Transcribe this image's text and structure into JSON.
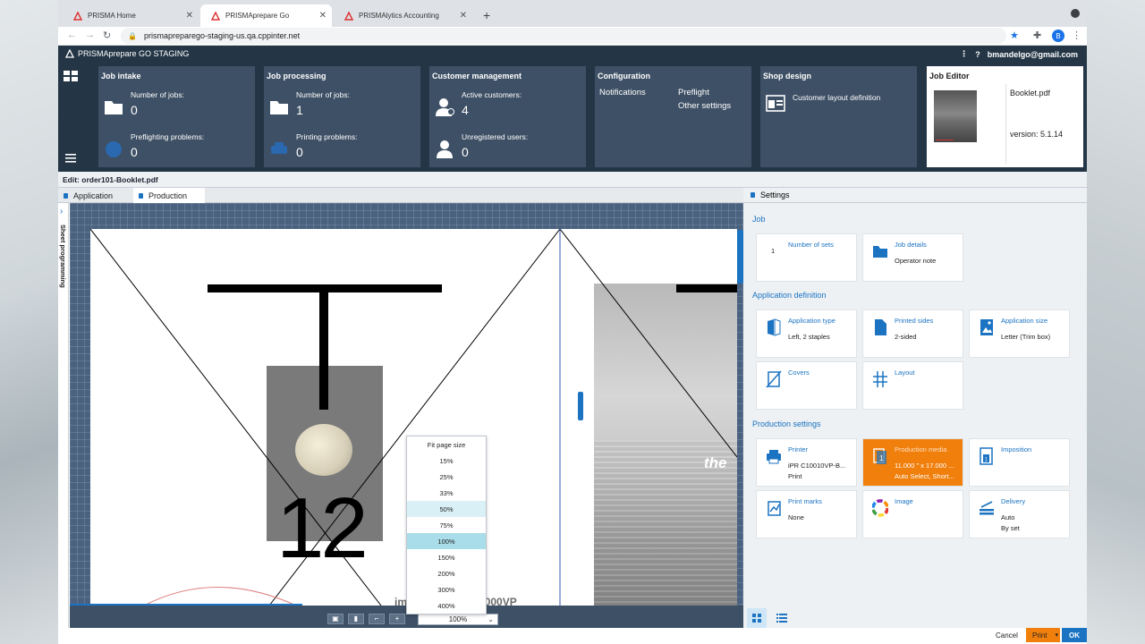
{
  "browser": {
    "tabs": [
      {
        "label": "PRISMA Home",
        "active": false
      },
      {
        "label": "PRISMAprepare Go",
        "active": true
      },
      {
        "label": "PRISMAlytics Accounting",
        "active": false
      }
    ],
    "url": "prismapreparego-staging-us.qa.cppinter.net",
    "avatar_letter": "B"
  },
  "app": {
    "title": "PRISMAprepare GO STAGING",
    "user": "bmandelgo@gmail.com"
  },
  "dashboard": {
    "job_intake": {
      "title": "Job intake",
      "stat1_label": "Number of jobs:",
      "stat1_value": "0",
      "stat2_label": "Preflighting problems:",
      "stat2_value": "0"
    },
    "job_processing": {
      "title": "Job processing",
      "stat1_label": "Number of jobs:",
      "stat1_value": "1",
      "stat2_label": "Printing problems:",
      "stat2_value": "0"
    },
    "customer_management": {
      "title": "Customer management",
      "stat1_label": "Active customers:",
      "stat1_value": "4",
      "stat2_label": "Unregistered users:",
      "stat2_value": "0"
    },
    "configuration": {
      "title": "Configuration",
      "notifications": "Notifications",
      "preflight": "Preflight",
      "other_settings": "Other settings"
    },
    "shop_design": {
      "title": "Shop design",
      "item": "Customer layout definition"
    },
    "job_editor": {
      "title": "Job Editor",
      "file": "Booklet.pdf",
      "version": "version: 5.1.14"
    }
  },
  "editor": {
    "edit_path": "Edit: order101-Booklet.pdf",
    "tabs": [
      "Application",
      "Production"
    ],
    "side_tab": "Sheet programming",
    "canvas": {
      "big_number": "12",
      "overlay_word": "the",
      "bottom_text": "imagePRESS C10000VP"
    },
    "zoom": {
      "current": "100%",
      "options": [
        "Fit page size",
        "15%",
        "25%",
        "33%",
        "50%",
        "75%",
        "100%",
        "150%",
        "200%",
        "300%",
        "400%"
      ],
      "hover": "50%",
      "selected": "100%"
    }
  },
  "settings": {
    "title": "Settings",
    "job": {
      "title": "Job",
      "number_of_sets": {
        "name": "Number of sets",
        "value": "1"
      },
      "job_details": {
        "name": "Job details",
        "value": "Operator note"
      }
    },
    "application_definition": {
      "title": "Application definition",
      "application_type": {
        "name": "Application type",
        "value": "Left, 2 staples"
      },
      "printed_sides": {
        "name": "Printed sides",
        "value": "2-sided"
      },
      "application_size": {
        "name": "Application size",
        "value": "Letter (Trim box)"
      },
      "covers": {
        "name": "Covers",
        "value": ""
      },
      "layout": {
        "name": "Layout",
        "value": ""
      }
    },
    "production_settings": {
      "title": "Production settings",
      "printer": {
        "name": "Printer",
        "value1": "iPR C10010VP-B...",
        "value2": "Print"
      },
      "production_media": {
        "name": "Production media",
        "value1": "11.000 \" x 17.000 ...",
        "value2": "Auto Select, Short..."
      },
      "imposition": {
        "name": "Imposition",
        "value": ""
      },
      "print_marks": {
        "name": "Print marks",
        "value": "None"
      },
      "image": {
        "name": "Image",
        "value": ""
      },
      "delivery": {
        "name": "Delivery",
        "value1": "Auto",
        "value2": "By set"
      }
    }
  },
  "footer": {
    "cancel": "Cancel",
    "print": "Print",
    "ok": "OK"
  },
  "colors": {
    "header_bg": "#243646",
    "card_bg": "#3e5065",
    "accent_blue": "#1b73c2",
    "accent_orange": "#f07f0c"
  }
}
